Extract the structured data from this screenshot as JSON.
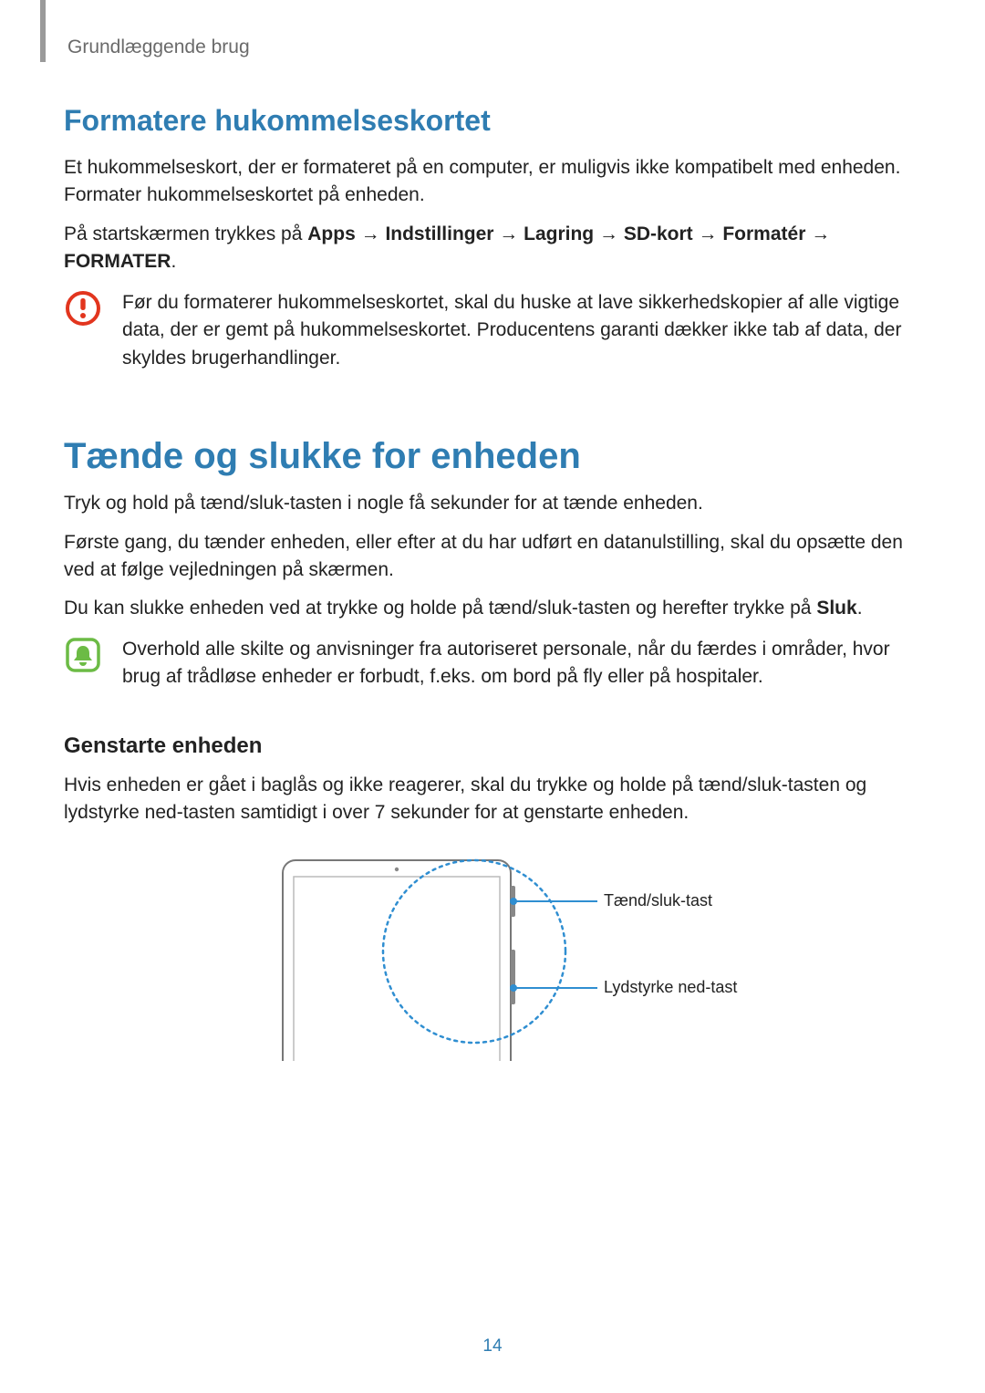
{
  "breadcrumb": "Grundlæggende brug",
  "format_section": {
    "heading": "Formatere hukommelseskortet",
    "p1": "Et hukommelseskort, der er formateret på en computer, er muligvis ikke kompatibelt med enheden. Formater hukommelseskortet på enheden.",
    "p2_lead": "På startskærmen trykkes på ",
    "p2_path": [
      "Apps",
      "Indstillinger",
      "Lagring",
      "SD-kort",
      "Formatér"
    ],
    "p2_final": "FORMATER",
    "arrow": "→",
    "warning": "Før du formaterer hukommelseskortet, skal du huske at lave sikkerhedskopier af alle vigtige data, der er gemt på hukommelseskortet. Producentens garanti dækker ikke tab af data, der skyldes brugerhandlinger."
  },
  "power_section": {
    "heading": "Tænde og slukke for enheden",
    "p1": "Tryk og hold på tænd/sluk-tasten i nogle få sekunder for at tænde enheden.",
    "p2": "Første gang, du tænder enheden, eller efter at du har udført en datanulstilling, skal du opsætte den ved at følge vejledningen på skærmen.",
    "p3_lead": "Du kan slukke enheden ved at trykke og holde på tænd/sluk-tasten og herefter trykke på ",
    "p3_bold": "Sluk",
    "note": "Overhold alle skilte og anvisninger fra autoriseret personale, når du færdes i områder, hvor brug af trådløse enheder er forbudt, f.eks. om bord på fly eller på hospitaler."
  },
  "restart_section": {
    "heading": "Genstarte enheden",
    "p1": "Hvis enheden er gået i baglås og ikke reagerer, skal du trykke og holde på tænd/sluk-tasten og lydstyrke ned-tasten samtidigt i over 7 sekunder for at genstarte enheden."
  },
  "diagram": {
    "label_power": "Tænd/sluk-tast",
    "label_voldown": "Lydstyrke ned-tast"
  },
  "page_number": "14"
}
